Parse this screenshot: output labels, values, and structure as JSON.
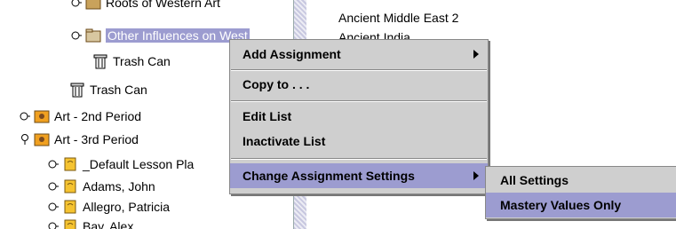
{
  "tree": {
    "items": [
      {
        "label": "Roots of Western Art"
      },
      {
        "label": "Other Influences on West"
      },
      {
        "label": "Trash Can"
      },
      {
        "label": "Trash Can"
      },
      {
        "label": "Art - 2nd Period"
      },
      {
        "label": "Art - 3rd Period"
      },
      {
        "label": "_Default Lesson Pla"
      },
      {
        "label": "Adams, John"
      },
      {
        "label": "Allegro, Patricia"
      },
      {
        "label": "Bay, Alex"
      }
    ]
  },
  "right_pane": {
    "lines": [
      "Ancient Middle East 2",
      "Ancient India"
    ]
  },
  "context_menu": {
    "items": [
      {
        "label": "Add Assignment"
      },
      {
        "label": "Copy to . . ."
      },
      {
        "label": "Edit List"
      },
      {
        "label": "Inactivate List"
      },
      {
        "label": "Change Assignment Settings"
      }
    ]
  },
  "submenu": {
    "items": [
      {
        "label": "All Settings"
      },
      {
        "label": "Mastery Values Only"
      }
    ]
  },
  "colors": {
    "highlight": "#9c9cd0",
    "menu_bg": "#cfcfcf"
  }
}
